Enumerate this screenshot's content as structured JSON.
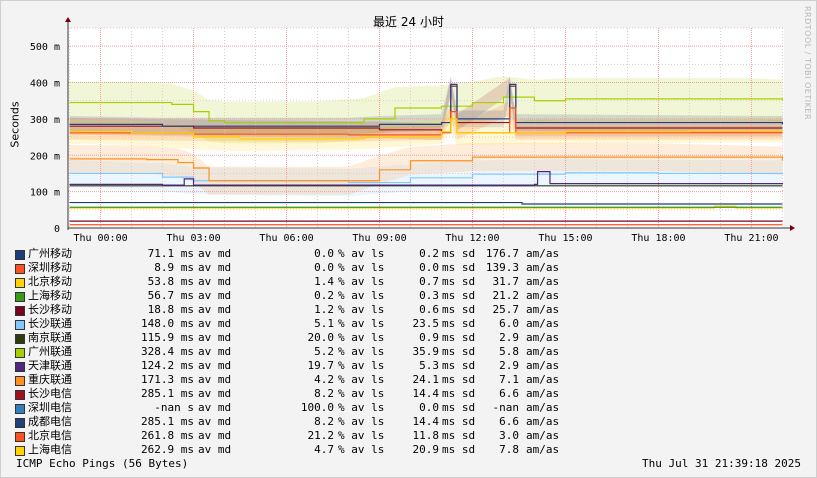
{
  "chart_data": {
    "type": "line",
    "title": "最近 24 小时",
    "ylabel": "Seconds",
    "y_unit_suffix": "m",
    "ylim": [
      0,
      550
    ],
    "y_ticks": [
      "0",
      "100 m",
      "200 m",
      "300 m",
      "400 m",
      "500 m"
    ],
    "x_ticks": [
      "Thu 00:00",
      "Thu 03:00",
      "Thu 06:00",
      "Thu 09:00",
      "Thu 12:00",
      "Thu 15:00",
      "Thu 18:00",
      "Thu 21:00"
    ],
    "x_hours_range": [
      -1.05,
      22.05
    ],
    "side_label": "RRDTOOL / TOBI OETIKER",
    "colors": {
      "grid_major": "#ee9f9f",
      "grid_minor": "#e6c8c8",
      "axis": "#333333",
      "arrow": "#7a0000"
    },
    "series": [
      {
        "name": "广州移动",
        "color": "#1a3f7a",
        "median": "71.1",
        "median_unit": "ms",
        "loss": "0.0",
        "sd": "0.2",
        "am": "176.7",
        "points": [
          [
            -1,
            70
          ],
          [
            13.5,
            70
          ],
          [
            13.6,
            66
          ],
          [
            22,
            66
          ]
        ]
      },
      {
        "name": "深圳移动",
        "color": "#ff5020",
        "median": "8.9",
        "median_unit": "ms",
        "loss": "0.0",
        "sd": "0.0",
        "am": "139.3",
        "points": [
          [
            -1,
            9
          ],
          [
            22,
            9
          ]
        ]
      },
      {
        "name": "北京移动",
        "color": "#ffd400",
        "median": "53.8",
        "median_unit": "ms",
        "loss": "1.4",
        "sd": "0.7",
        "am": "31.7",
        "points": [
          [
            -1,
            55
          ],
          [
            19.5,
            55
          ],
          [
            19.8,
            60
          ],
          [
            20.5,
            55
          ],
          [
            22,
            55
          ]
        ]
      },
      {
        "name": "上海移动",
        "color": "#3a9a1a",
        "median": "56.7",
        "median_unit": "ms",
        "loss": "0.2",
        "sd": "0.3",
        "am": "21.2",
        "points": [
          [
            -1,
            57
          ],
          [
            22,
            57
          ]
        ]
      },
      {
        "name": "长沙移动",
        "color": "#7a0020",
        "median": "18.8",
        "median_unit": "ms",
        "loss": "1.2",
        "sd": "0.6",
        "am": "25.7",
        "points": [
          [
            -1,
            19
          ],
          [
            22,
            19
          ]
        ]
      },
      {
        "name": "长沙联通",
        "color": "#80c8ff",
        "median": "148.0",
        "median_unit": "ms",
        "loss": "5.1",
        "sd": "23.5",
        "am": "6.0",
        "points": [
          [
            -1,
            150
          ],
          [
            2,
            140
          ],
          [
            3,
            130
          ],
          [
            8,
            125
          ],
          [
            10,
            138
          ],
          [
            12,
            148
          ],
          [
            15,
            152
          ],
          [
            18,
            150
          ],
          [
            22,
            148
          ]
        ]
      },
      {
        "name": "南京联通",
        "color": "#303a10",
        "median": "115.9",
        "median_unit": "ms",
        "loss": "20.0",
        "sd": "0.9",
        "am": "2.9",
        "points": [
          [
            -1,
            116
          ],
          [
            22,
            116
          ]
        ]
      },
      {
        "name": "广州联通",
        "color": "#a8d000",
        "median": "328.4",
        "median_unit": "ms",
        "loss": "5.2",
        "sd": "35.9",
        "am": "5.8",
        "points": [
          [
            -1,
            345
          ],
          [
            1,
            345
          ],
          [
            2.3,
            340
          ],
          [
            3,
            320
          ],
          [
            3.5,
            295
          ],
          [
            4,
            290
          ],
          [
            7,
            290
          ],
          [
            8.5,
            300
          ],
          [
            9.5,
            330
          ],
          [
            11,
            335
          ],
          [
            12,
            345
          ],
          [
            13,
            360
          ],
          [
            14,
            350
          ],
          [
            15,
            355
          ],
          [
            18,
            355
          ],
          [
            21,
            355
          ],
          [
            22,
            350
          ]
        ]
      },
      {
        "name": "天津联通",
        "color": "#502880",
        "median": "124.2",
        "median_unit": "ms",
        "loss": "19.7",
        "sd": "5.3",
        "am": "2.9",
        "points": [
          [
            -1,
            120
          ],
          [
            2,
            118
          ],
          [
            2.7,
            135
          ],
          [
            3,
            118
          ],
          [
            14,
            120
          ],
          [
            14.1,
            155
          ],
          [
            14.5,
            122
          ],
          [
            22,
            120
          ]
        ]
      },
      {
        "name": "重庆联通",
        "color": "#ff9020",
        "median": "171.3",
        "median_unit": "ms",
        "loss": "4.2",
        "sd": "24.1",
        "am": "7.1",
        "points": [
          [
            -1,
            190
          ],
          [
            1.5,
            188
          ],
          [
            2.5,
            180
          ],
          [
            3,
            165
          ],
          [
            3.5,
            130
          ],
          [
            8,
            130
          ],
          [
            9,
            160
          ],
          [
            10,
            185
          ],
          [
            12,
            195
          ],
          [
            15,
            195
          ],
          [
            18,
            195
          ],
          [
            22,
            185
          ]
        ]
      },
      {
        "name": "长沙电信",
        "color": "#a01020",
        "median": "285.1",
        "median_unit": "ms",
        "loss": "8.2",
        "sd": "14.4",
        "am": "6.6",
        "points": [
          [
            -1,
            280
          ],
          [
            3,
            275
          ],
          [
            9,
            270
          ],
          [
            11,
            265
          ],
          [
            11.3,
            390
          ],
          [
            11.5,
            290
          ],
          [
            13.2,
            390
          ],
          [
            13.4,
            275
          ],
          [
            22,
            275
          ]
        ]
      },
      {
        "name": "深圳电信",
        "color": "#3080c0",
        "median": "-nan",
        "median_unit": "s",
        "loss": "100.0",
        "sd": "0.0",
        "am": "-nan",
        "points": []
      },
      {
        "name": "成都电信",
        "color": "#204080",
        "median": "285.1",
        "median_unit": "ms",
        "loss": "8.2",
        "sd": "14.4",
        "am": "6.6",
        "points": [
          [
            -1,
            285
          ],
          [
            2,
            280
          ],
          [
            3,
            280
          ],
          [
            8,
            280
          ],
          [
            9,
            285
          ],
          [
            11,
            290
          ],
          [
            11.3,
            395
          ],
          [
            11.5,
            300
          ],
          [
            13,
            300
          ],
          [
            13.2,
            395
          ],
          [
            13.4,
            290
          ],
          [
            22,
            285
          ]
        ]
      },
      {
        "name": "北京电信",
        "color": "#ff5020",
        "median": "261.8",
        "median_unit": "ms",
        "loss": "21.2",
        "sd": "11.8",
        "am": "3.0",
        "points": [
          [
            -1,
            262
          ],
          [
            3,
            258
          ],
          [
            8,
            256
          ],
          [
            11,
            262
          ],
          [
            11.3,
            320
          ],
          [
            11.5,
            262
          ],
          [
            13.2,
            330
          ],
          [
            13.4,
            262
          ],
          [
            22,
            262
          ]
        ]
      },
      {
        "name": "上海电信",
        "color": "#ffd400",
        "median": "262.9",
        "median_unit": "ms",
        "loss": "4.7",
        "sd": "20.9",
        "am": "7.8",
        "points": [
          [
            -1,
            265
          ],
          [
            1,
            262
          ],
          [
            3,
            250
          ],
          [
            4.5,
            245
          ],
          [
            8.5,
            250
          ],
          [
            11,
            265
          ],
          [
            11.3,
            300
          ],
          [
            11.5,
            262
          ],
          [
            15,
            265
          ],
          [
            19,
            268
          ],
          [
            22,
            270
          ]
        ]
      }
    ],
    "stat_labels": {
      "median": "av md",
      "loss": "% av ls",
      "sd": "ms sd",
      "am": "am/as"
    }
  },
  "footer": {
    "left": "ICMP Echo Pings (56 Bytes)",
    "right": "Thu Jul 31 21:39:18 2025"
  }
}
